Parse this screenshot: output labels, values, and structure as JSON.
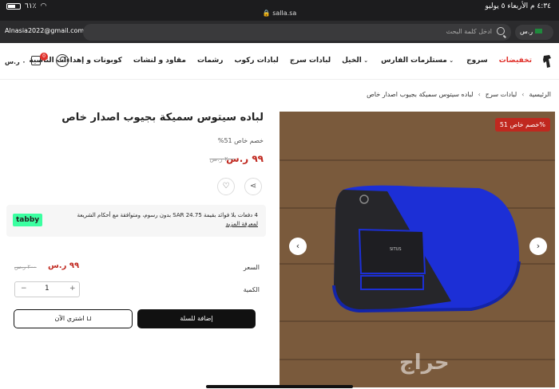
{
  "status_bar": {
    "time_date": "٤:٣٤ م  الأربعاء ٥ يوليو",
    "battery": "٦١٪",
    "url": "salla.sa"
  },
  "top_bar": {
    "email": "Alnasia2022@gmail.com",
    "search_placeholder": "ادخل كلمة البحث",
    "currency": "ر.س"
  },
  "nav": {
    "items": [
      {
        "label": "تخفيضات"
      },
      {
        "label": "سروج"
      },
      {
        "label": "مستلزمات الفارس"
      },
      {
        "label": "الخيل"
      },
      {
        "label": "لبادات سرج"
      },
      {
        "label": "لبادات ركوب"
      },
      {
        "label": "رشمات"
      },
      {
        "label": "مقاود و لنشات"
      },
      {
        "label": "كوبونات و إهداءات الناصية"
      }
    ],
    "cart_count": "0",
    "cart_total": "٠ ر.س"
  },
  "breadcrumb": {
    "items": [
      "الرئيسية",
      "لبادات سرج",
      "لباده سيتوس سميكة بجيوب اصدار خاص"
    ]
  },
  "product": {
    "title": "لباده سيتوس سميكة بجيوب اصدار خاص",
    "discount_text": "خصم خاص 51%",
    "price": "٩٩ ر.س",
    "old_price": "٢٠٠ ر.س",
    "sale_badge": "خصم خاص 51%",
    "pocket_label": "SITUS"
  },
  "tabby": {
    "logo": "tabby",
    "text": "4 دفعات بلا فوائد بقيمة SAR 24.75 بدون رسوم، ومتوافقة مع أحكام الشريعة",
    "link": "لمعرفة المزيد"
  },
  "buybox": {
    "price_label": "السعر",
    "price": "٩٩ ر.س",
    "old_price": "٢٠٠ ر.س",
    "qty_label": "الكمية",
    "qty": "1",
    "add_to_cart": "إضافة للسلة",
    "buy_now": "اشتري الآن"
  },
  "gallery": {
    "watermark": "حراج"
  },
  "colors": {
    "accent": "#e0312b",
    "sale_red": "#c0281f",
    "pad_blue": "#1c2fd6",
    "tabby_green": "#3bffa1"
  }
}
